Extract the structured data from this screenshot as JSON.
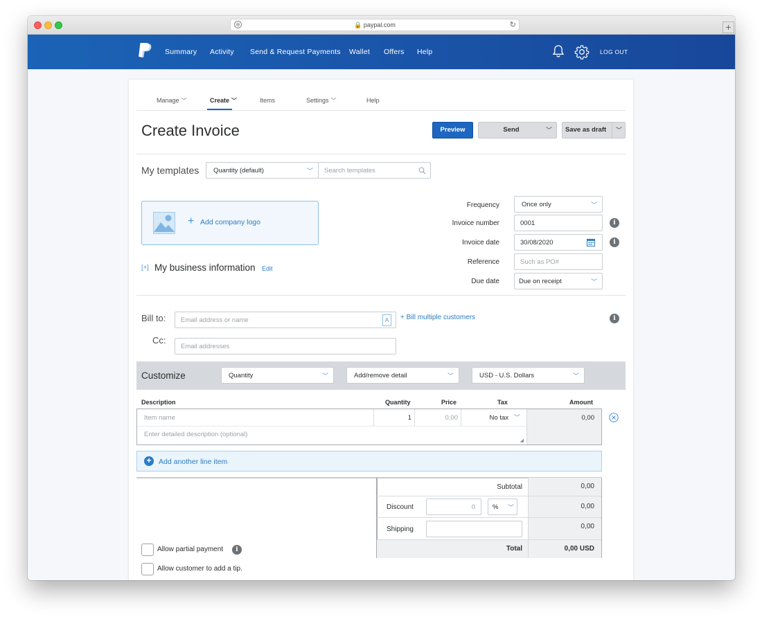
{
  "browser": {
    "url": "paypal.com"
  },
  "nav": {
    "items": [
      "Summary",
      "Activity",
      "Send & Request Payments",
      "Wallet",
      "Offers",
      "Help"
    ],
    "logout": "LOG OUT"
  },
  "subnav": {
    "manage": "Manage",
    "create": "Create",
    "items": "Items",
    "settings": "Settings",
    "help": "Help"
  },
  "title": "Create Invoice",
  "buttons": {
    "preview": "Preview",
    "send": "Send",
    "save_draft": "Save as draft"
  },
  "templates": {
    "label": "My templates",
    "selected": "Quantity (default)",
    "search_placeholder": "Search templates"
  },
  "logo": {
    "add_label": "Add company logo"
  },
  "business": {
    "bracket": "[+]",
    "label": "My business information",
    "edit": "Edit"
  },
  "details": {
    "frequency_label": "Frequency",
    "frequency_value": "Once only",
    "invoice_number_label": "Invoice number",
    "invoice_number_value": "0001",
    "invoice_date_label": "Invoice date",
    "invoice_date_value": "30/08/2020",
    "reference_label": "Reference",
    "reference_placeholder": "Such as PO#",
    "due_date_label": "Due date",
    "due_date_value": "Due on receipt"
  },
  "billing": {
    "bill_to_label": "Bill to:",
    "bill_to_placeholder": "Email address or name",
    "bill_multiple": "+ Bill multiple customers",
    "cc_label": "Cc:",
    "cc_placeholder": "Email addresses"
  },
  "customize": {
    "label": "Customize",
    "quantity": "Quantity",
    "detail": "Add/remove detail",
    "currency": "USD - U.S. Dollars"
  },
  "columns": {
    "description": "Description",
    "quantity": "Quantity",
    "price": "Price",
    "tax": "Tax",
    "amount": "Amount"
  },
  "line_item": {
    "name_placeholder": "Item name",
    "quantity": "1",
    "price_placeholder": "0,00",
    "tax": "No tax",
    "amount": "0,00",
    "description_placeholder": "Enter detailed description (optional)"
  },
  "add_line": "Add another line item",
  "totals": {
    "subtotal_label": "Subtotal",
    "subtotal_value": "0,00",
    "discount_label": "Discount",
    "discount_input": "0",
    "discount_unit": "%",
    "discount_value": "0,00",
    "shipping_label": "Shipping",
    "shipping_value": "0,00",
    "total_label": "Total",
    "total_value": "0,00 USD"
  },
  "options": {
    "partial_payment": "Allow partial payment",
    "tip": "Allow customer to add a tip."
  },
  "colors": {
    "header_blue": "#1a54a8",
    "accent_blue": "#1d67c1",
    "link_blue": "#2b7cc6"
  }
}
